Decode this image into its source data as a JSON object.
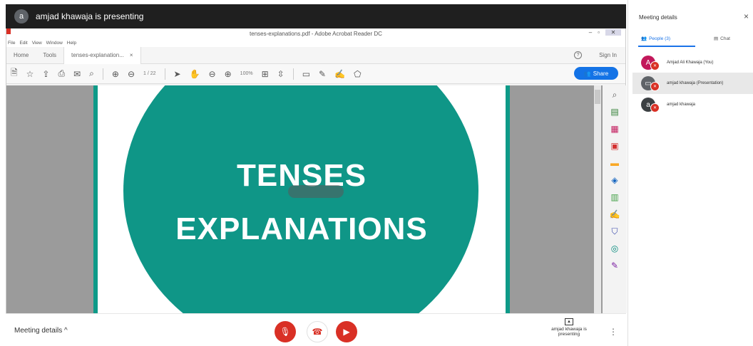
{
  "presenting_bar": {
    "avatar_letter": "a",
    "text": "amjad khawaja is presenting"
  },
  "acrobat": {
    "window_title": "tenses-explanations.pdf - Adobe Acrobat Reader DC",
    "menu": [
      "File",
      "Edit",
      "View",
      "Window",
      "Help"
    ],
    "tabs": {
      "home": "Home",
      "tools": "Tools",
      "document": "tenses-explanation...",
      "close": "×"
    },
    "help": "?",
    "sign_in": "Sign In",
    "page_indicator": "1 / 22",
    "zoom": "100%",
    "share_label": "Share"
  },
  "slide": {
    "line1": "TENSES",
    "line2": "EXPLANATIONS"
  },
  "bottom": {
    "meeting_details": "Meeting details ^",
    "presenting_label": "amjad khawaja is presenting"
  },
  "panel": {
    "title": "Meeting details",
    "close": "×",
    "people_tab": "People (3)",
    "chat_tab": "Chat",
    "participants": [
      {
        "initial": "A",
        "name": "Amjad Ali Khawaja (You)",
        "color": "#c2185b"
      },
      {
        "initial": "▭",
        "name": "amjad khawaja (Presentation)",
        "color": "#5f6368"
      },
      {
        "initial": "a",
        "name": "amjad khawaja",
        "color": "#3c4043"
      }
    ]
  },
  "colors": {
    "teal": "#0f9687",
    "mic_red": "#d93025",
    "accent": "#1a73e8"
  }
}
